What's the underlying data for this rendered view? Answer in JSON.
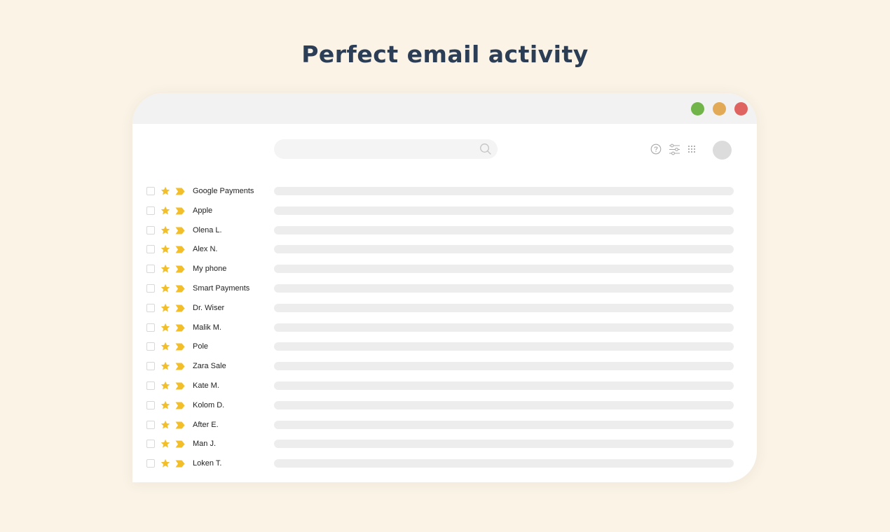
{
  "headline": "Perfect email activity",
  "window_controls": [
    {
      "name": "maximize-button",
      "color": "#71b44a"
    },
    {
      "name": "minimize-button",
      "color": "#e2aa56"
    },
    {
      "name": "close-button",
      "color": "#df6360"
    }
  ],
  "toolbar": {
    "search_placeholder": "",
    "icons": [
      "search-icon",
      "help-icon",
      "sliders-icon",
      "apps-grid-icon",
      "avatar"
    ]
  },
  "colors": {
    "background": "#faf3e6",
    "headline": "#2c3e56",
    "star": "#f2bf2b",
    "tag": "#f2bf2b"
  },
  "emails": [
    {
      "sender": "Google Payments"
    },
    {
      "sender": "Apple"
    },
    {
      "sender": "Olena L."
    },
    {
      "sender": "Alex N."
    },
    {
      "sender": "My phone"
    },
    {
      "sender": "Smart Payments"
    },
    {
      "sender": "Dr. Wiser"
    },
    {
      "sender": "Malik M."
    },
    {
      "sender": "Pole"
    },
    {
      "sender": "Zara Sale"
    },
    {
      "sender": "Kate M."
    },
    {
      "sender": "Kolom D."
    },
    {
      "sender": "After E."
    },
    {
      "sender": "Man J."
    },
    {
      "sender": "Loken T."
    }
  ]
}
